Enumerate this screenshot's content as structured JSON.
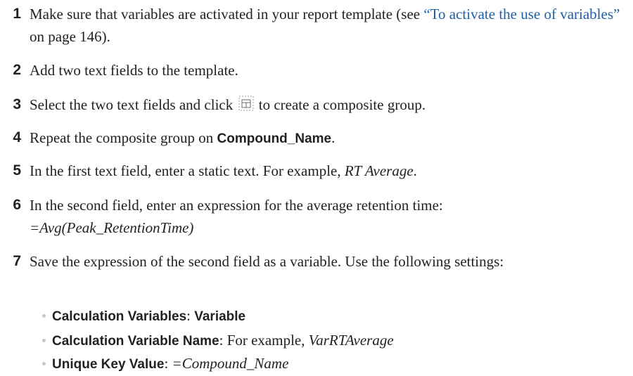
{
  "colors": {
    "text": "#222222",
    "link": "#1f5fa8",
    "bullet": "#c8c8c8"
  },
  "steps": {
    "s1": {
      "num": "1",
      "a": "Make sure that variables are activated in your report template (see ",
      "link": "“To activate the use of variables”",
      "b": " on page 146)."
    },
    "s2": {
      "num": "2",
      "a": "Add two text fields to the template."
    },
    "s3": {
      "num": "3",
      "a": "Select the two text fields and click",
      "icon": "composite-group-icon",
      "b": "to create a composite group."
    },
    "s4": {
      "num": "4",
      "a": "Repeat the composite group on ",
      "bold": "Compound_Name",
      "b": "."
    },
    "s5": {
      "num": "5",
      "a": "In the first text field, enter a static text. For example, ",
      "italic": "RT Average",
      "b": "."
    },
    "s6": {
      "num": "6",
      "a": "In the second field, enter an expression for the average retention time:",
      "expr": "=Avg(Peak_RetentionTime)"
    },
    "s7": {
      "num": "7",
      "a": "Save the expression of the second field as a variable. Use the following settings:"
    }
  },
  "settings": [
    {
      "label": "Calculation Variables",
      "sep": ": ",
      "value": "Variable",
      "value_style": "bold"
    },
    {
      "label": "Calculation Variable Name",
      "sep": ": ",
      "value_prefix": "For example, ",
      "value": "VarRTAverage",
      "value_style": "italic"
    },
    {
      "label": "Unique Key Value",
      "sep": ": ",
      "value": "=Compound_Name",
      "value_style": "italic"
    }
  ]
}
